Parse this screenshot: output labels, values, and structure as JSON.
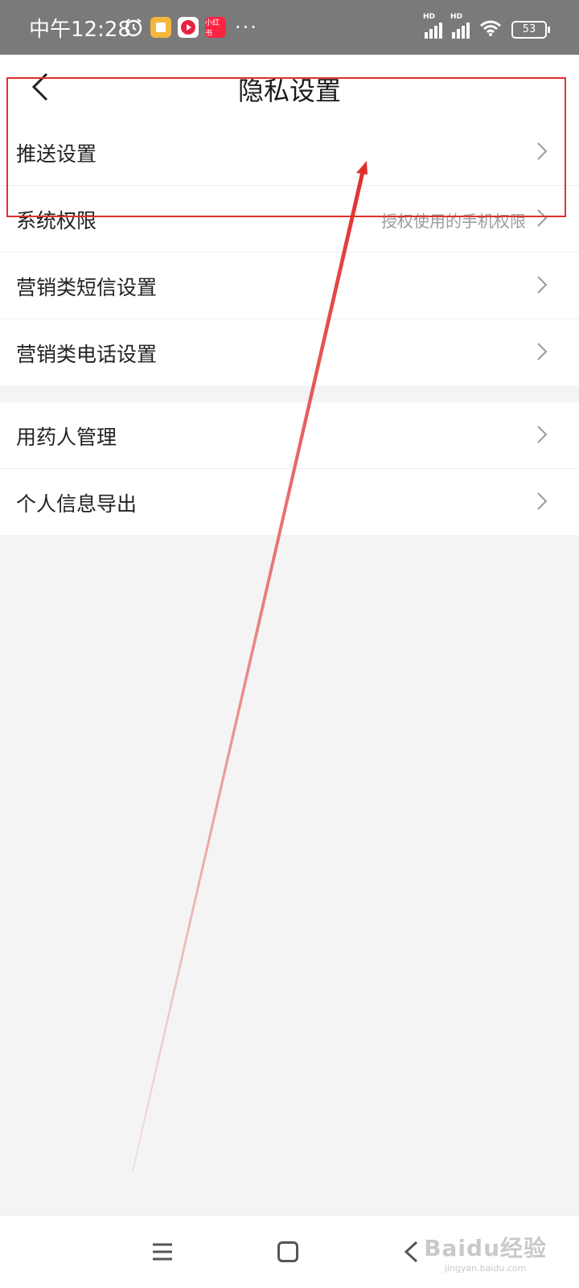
{
  "status_bar": {
    "time": "中午12:28",
    "app_icon_label": "小红书",
    "more": "···",
    "signal_label_1": "HD",
    "signal_label_2": "HD",
    "battery": "53"
  },
  "header": {
    "title": "隐私设置"
  },
  "group1": {
    "items": [
      {
        "label": "推送设置",
        "sub": ""
      },
      {
        "label": "系统权限",
        "sub": "授权使用的手机权限"
      },
      {
        "label": "营销类短信设置",
        "sub": ""
      },
      {
        "label": "营销类电话设置",
        "sub": ""
      }
    ]
  },
  "group2": {
    "items": [
      {
        "label": "用药人管理",
        "sub": ""
      },
      {
        "label": "个人信息导出",
        "sub": ""
      }
    ]
  },
  "watermark": {
    "main": "Baidu经验",
    "sub": "jingyan.baidu.com"
  },
  "colors": {
    "accent": "#e0302e",
    "status_bar_bg": "#7a7a7a",
    "page_bg": "#f4f4f4"
  }
}
